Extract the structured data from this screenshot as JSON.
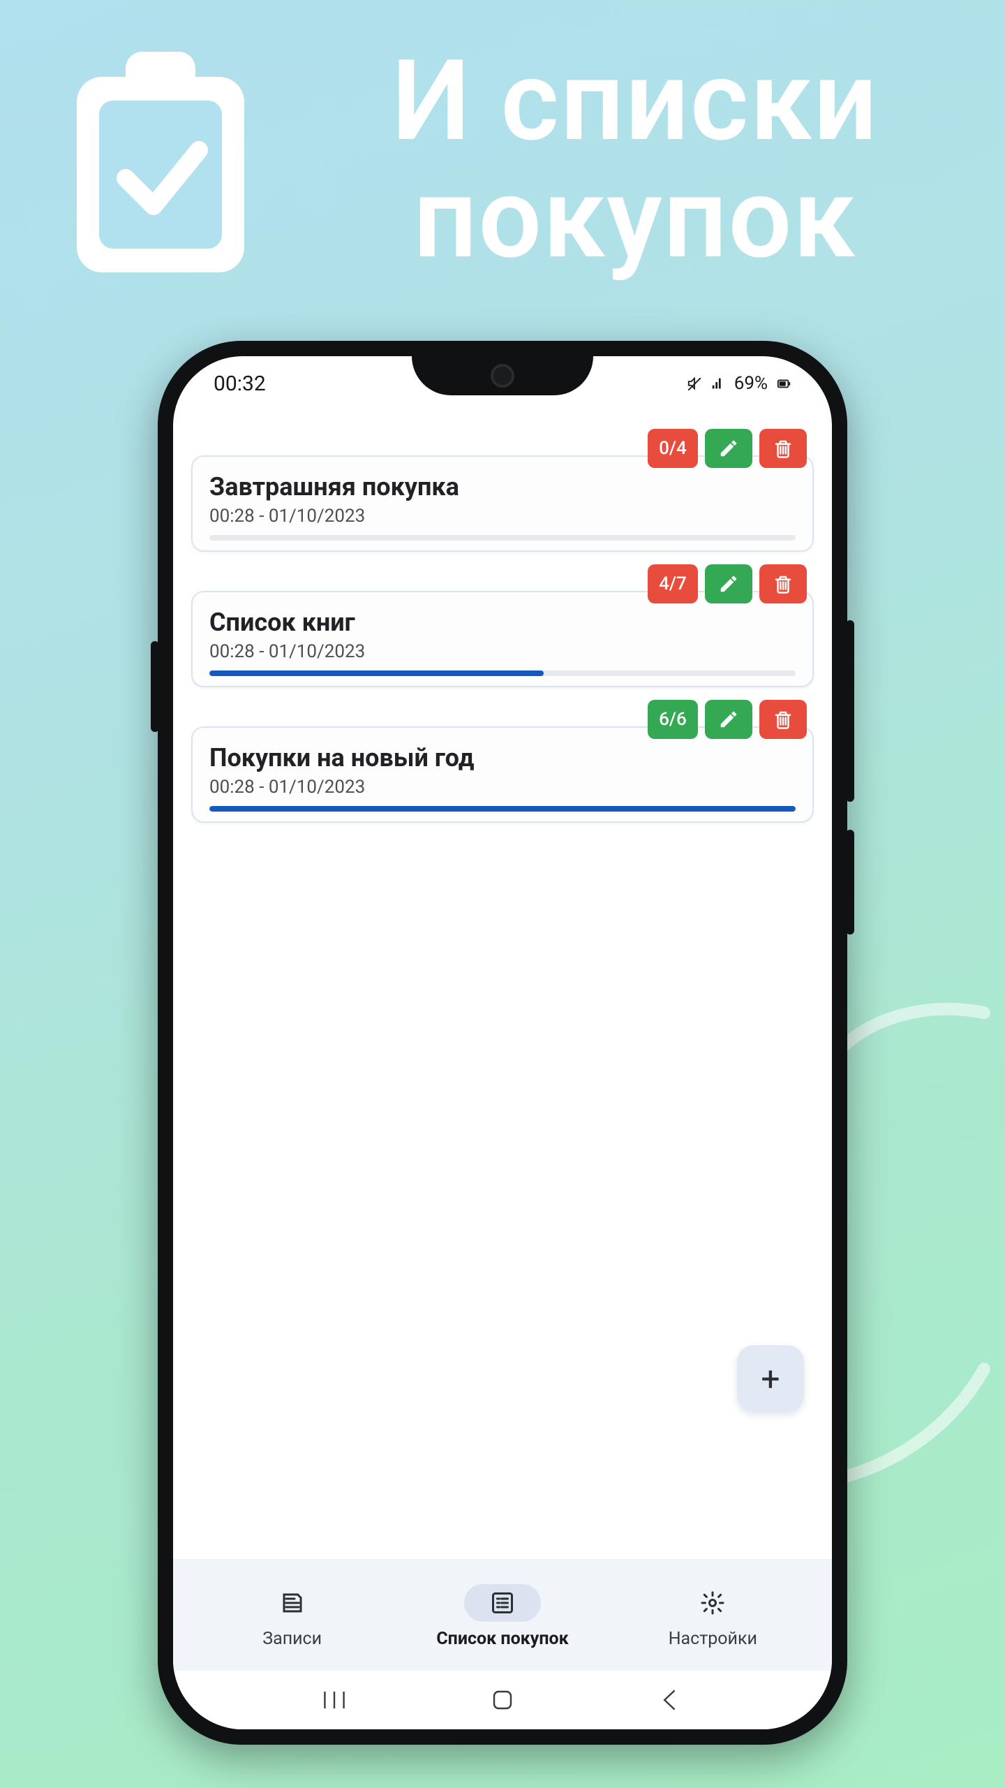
{
  "promo": {
    "headline": "И списки\nпокупок"
  },
  "status": {
    "time": "00:32",
    "battery": "69%"
  },
  "lists": [
    {
      "title": "Завтрашняя покупка",
      "subtitle": "00:28 - 01/10/2023",
      "done": 0,
      "total": 4,
      "badge_text": "0/4",
      "badge_color": "red",
      "progress_pct": 0
    },
    {
      "title": "Список книг",
      "subtitle": "00:28 - 01/10/2023",
      "done": 4,
      "total": 7,
      "badge_text": "4/7",
      "badge_color": "red",
      "progress_pct": 57
    },
    {
      "title": "Покупки на новый год",
      "subtitle": "00:28 - 01/10/2023",
      "done": 6,
      "total": 6,
      "badge_text": "6/6",
      "badge_color": "green",
      "progress_pct": 100
    }
  ],
  "fab": {
    "label": "+"
  },
  "nav": {
    "items": [
      {
        "label": "Записи",
        "icon": "note",
        "active": false
      },
      {
        "label": "Список покупок",
        "icon": "list",
        "active": true
      },
      {
        "label": "Настройки",
        "icon": "settings",
        "active": false
      }
    ]
  },
  "colors": {
    "red": "#e74c3c",
    "green": "#34a853",
    "progress": "#1558c0"
  }
}
